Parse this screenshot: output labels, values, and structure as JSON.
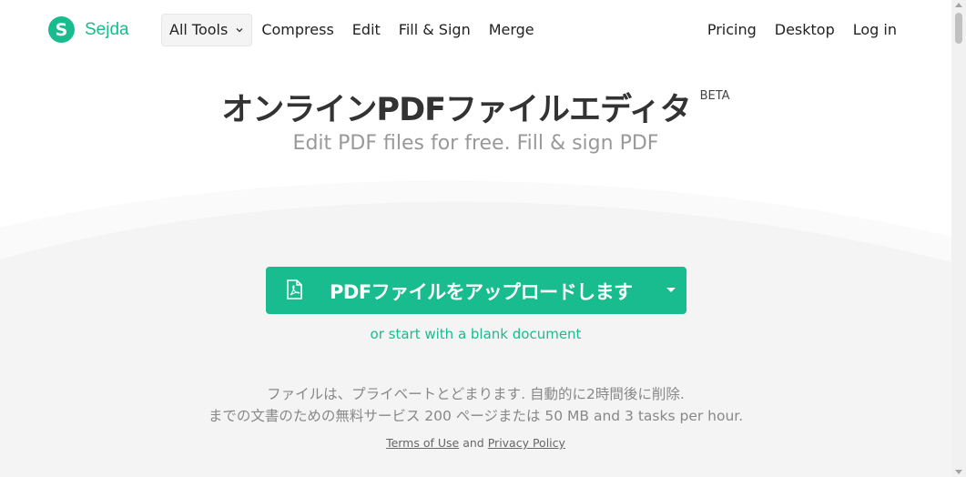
{
  "logo": {
    "mark": "S",
    "name": "Sejda"
  },
  "nav": {
    "all_tools": "All Tools",
    "compress": "Compress",
    "edit": "Edit",
    "fill_sign": "Fill & Sign",
    "merge": "Merge",
    "pricing": "Pricing",
    "desktop": "Desktop",
    "login": "Log in"
  },
  "hero": {
    "title": "オンラインPDFファイルエディタ",
    "badge": "BETA",
    "subtitle": "Edit PDF files for free. Fill & sign PDF"
  },
  "upload": {
    "button_label": "PDFファイルをアップロードします",
    "icon": "pdf-file-icon",
    "dropdown_icon": "caret-down-icon",
    "blank_link": "or start with a blank document"
  },
  "info": {
    "line1": "ファイルは、プライベートとどまります. 自動的に2時間後に削除.",
    "line2": "までの文書のための無料サービス 200 ページまたは 50 MB and 3 tasks per hour."
  },
  "legal": {
    "terms": "Terms of Use",
    "and": "and",
    "privacy": "Privacy Policy"
  },
  "colors": {
    "brand": "#19bc8e",
    "wave": "#f4f4f4"
  }
}
